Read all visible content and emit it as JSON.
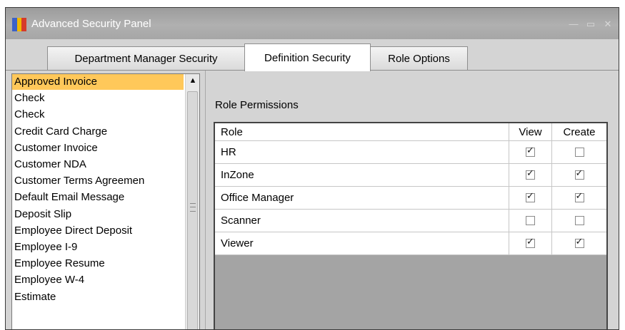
{
  "window": {
    "title": "Advanced Security Panel",
    "controls": [
      "—",
      "▭",
      "✕"
    ],
    "icon_colors": [
      "#3c62c8",
      "#f0b800",
      "#d63b2a"
    ]
  },
  "tabs": [
    {
      "label": "Department Manager Security"
    },
    {
      "label": "Definition Security"
    },
    {
      "label": "Role Options"
    }
  ],
  "active_tab": "Definition Security",
  "definitions": {
    "selected": "Approved Invoice",
    "scroll_up_arrow": "▲",
    "items": [
      "Approved Invoice",
      "Check",
      "Check",
      "Credit Card Charge",
      "Customer Invoice",
      "Customer NDA",
      "Customer Terms Agreemen",
      "Default Email Message",
      "Deposit Slip",
      "Employee Direct Deposit",
      "Employee I-9",
      "Employee Resume",
      "Employee W-4",
      "Estimate"
    ]
  },
  "permissions": {
    "title": "Role Permissions",
    "columns": {
      "role": "Role",
      "view": "View",
      "create": "Create"
    },
    "rows": [
      {
        "role": "HR",
        "view": true,
        "create": false
      },
      {
        "role": "InZone",
        "view": true,
        "create": true
      },
      {
        "role": "Office Manager",
        "view": true,
        "create": true
      },
      {
        "role": "Scanner",
        "view": false,
        "create": false
      },
      {
        "role": "Viewer",
        "view": true,
        "create": true
      }
    ]
  },
  "colors": {
    "selection": "#ffc85a",
    "titlebar": "#a6a6a6"
  }
}
